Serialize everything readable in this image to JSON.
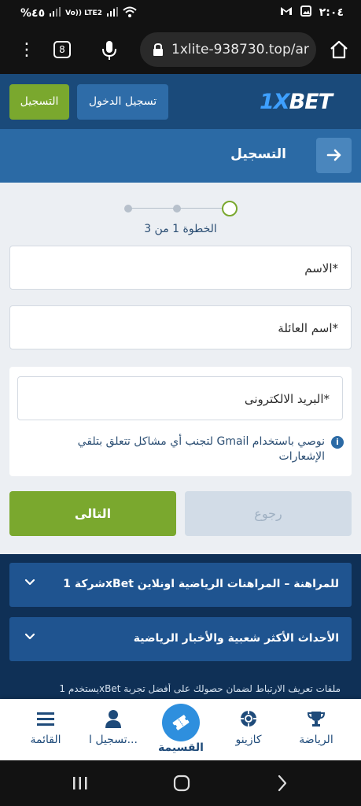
{
  "status_bar": {
    "time": "٢:٠٤",
    "battery": "%٤٥",
    "network_label": "Vo)) LTE2"
  },
  "browser": {
    "url": "1xlite-938730.top/ar",
    "tab_count": "8"
  },
  "header": {
    "logo_prefix": "1X",
    "logo_suffix": "BET",
    "login_label": "تسجيل الدخول",
    "register_label": "التسجيل"
  },
  "registration": {
    "title": "التسجيل",
    "step_text": "الخطوة 1 من 3",
    "first_name_placeholder": "الاسم*",
    "last_name_placeholder": "اسم العائلة*",
    "email_placeholder": "البريد الالكترونى*",
    "email_note": "نوصي باستخدام Gmail لتجنب أي مشاكل تتعلق بتلقي الإشعارات",
    "back_label": "رجوع",
    "next_label": "التالى"
  },
  "accordions": [
    {
      "title": "شركة 1xBet للمراهنة – المراهنات الرياضية اونلاين"
    },
    {
      "title": "الأحداث الأكثر شعبية والأخبار الرياضية"
    }
  ],
  "cookie_notice": "يستخدم 1xBet ملفات تعريف الارتباط لضمان حصولك على أفضل تجربة",
  "bottom_nav": {
    "sports": "الرياضة",
    "casino": "كازينو",
    "coupon": "القسيمة",
    "login": "تسجيل ا...",
    "menu": "القائمة"
  },
  "colors": {
    "accent_green": "#7aa82e",
    "header_blue": "#1a4a7a",
    "title_blue": "#2b6aa5",
    "footer_blue": "#0f3056"
  }
}
